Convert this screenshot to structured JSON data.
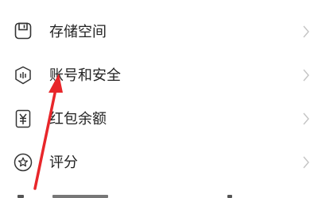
{
  "settings_menu": {
    "items": [
      {
        "label": "存储空间",
        "icon": "storage-icon"
      },
      {
        "label": "账号和安全",
        "icon": "shield-icon"
      },
      {
        "label": "红包余额",
        "icon": "wallet-yuan-icon"
      },
      {
        "label": "评分",
        "icon": "star-badge-icon"
      }
    ],
    "chevron_icon": "chevron-right-icon"
  },
  "annotation": {
    "arrow_color": "#e8262a"
  }
}
